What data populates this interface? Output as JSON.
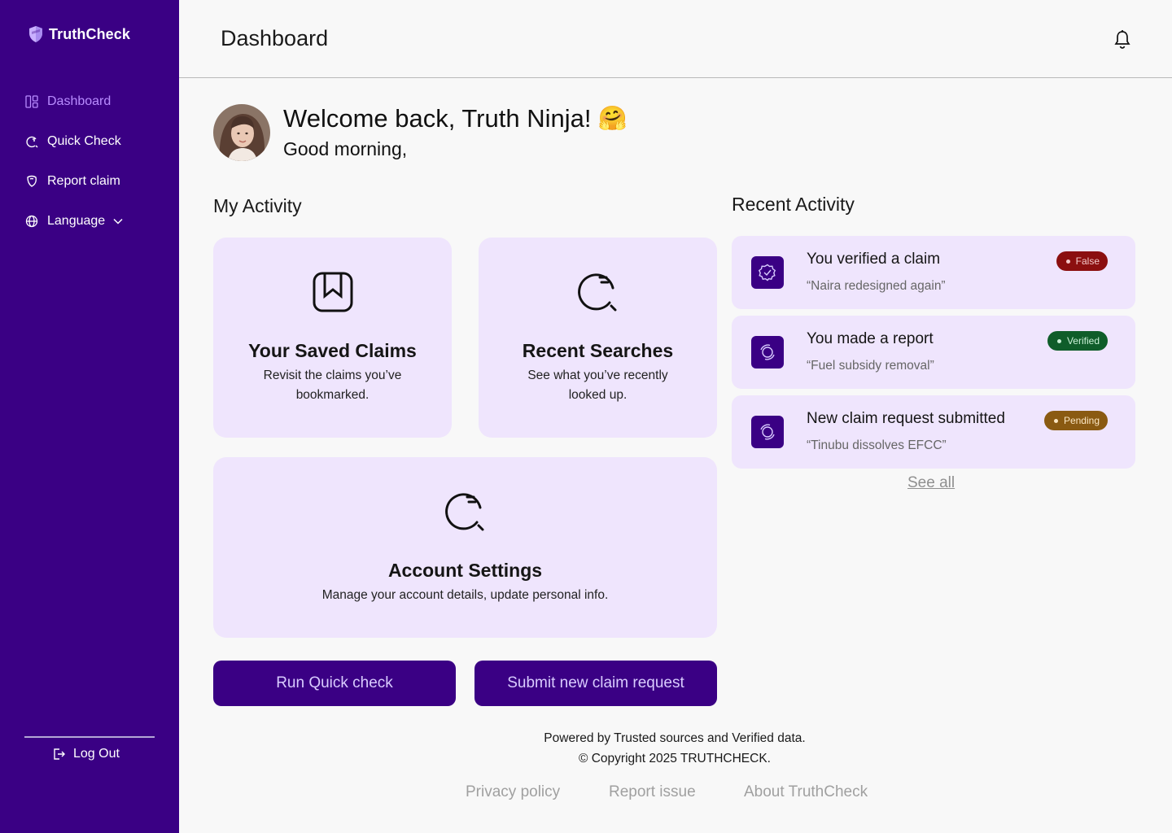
{
  "app": {
    "name": "TruthCheck"
  },
  "sidebar": {
    "items": [
      {
        "label": "Dashboard",
        "icon": "dashboard-icon",
        "active": true
      },
      {
        "label": "Quick Check",
        "icon": "quick-check-icon"
      },
      {
        "label": "Report claim",
        "icon": "report-icon"
      },
      {
        "label": "Language",
        "icon": "globe-icon",
        "has_dropdown": true
      }
    ],
    "logout_label": "Log Out"
  },
  "header": {
    "title": "Dashboard"
  },
  "welcome": {
    "title": "Welcome back, Truth Ninja!",
    "emoji": "🤗",
    "subtitle": "Good morning,"
  },
  "my_activity": {
    "title": "My Activity",
    "cards": [
      {
        "title": "Your Saved Claims",
        "desc_lines": [
          "Revisit the claims you’ve",
          "bookmarked."
        ],
        "icon": "bookmark-icon"
      },
      {
        "title": "Recent Searches",
        "desc_lines": [
          "See what you’ve recently",
          "looked up."
        ],
        "icon": "search-refresh-icon"
      },
      {
        "title": "Account Settings",
        "desc_lines": [
          "Manage your account details, update personal info."
        ],
        "icon": "search-refresh-icon"
      }
    ],
    "buttons": {
      "quick_check": "Run Quick check",
      "submit_claim": "Submit new claim request"
    }
  },
  "recent_activity": {
    "title": "Recent Activity",
    "items": [
      {
        "title": "You verified a claim",
        "quote": "“Naira redesigned again”",
        "badge": "False",
        "icon": "verified-badge-icon"
      },
      {
        "title": "You made a report",
        "quote": "“Fuel subsidy removal”",
        "badge": "Verified",
        "icon": "report-circle-icon"
      },
      {
        "title": "New claim request submitted",
        "quote": "“Tinubu dissolves EFCC”",
        "badge": "Pending",
        "icon": "report-circle-icon"
      }
    ],
    "see_all": "See all"
  },
  "footer": {
    "line1": "Powered by Trusted sources and Verified data.",
    "line2": "© Copyright 2025 TRUTHCHECK.",
    "links": [
      "Privacy policy",
      "Report issue",
      "About TruthCheck"
    ]
  },
  "colors": {
    "brand": "#3a0084",
    "card_bg": "#efe5fd",
    "active_nav": "#b98cff",
    "badge_false": "#8b0f0f",
    "badge_verified": "#0f5d2a",
    "badge_pending": "#8a5a12"
  }
}
